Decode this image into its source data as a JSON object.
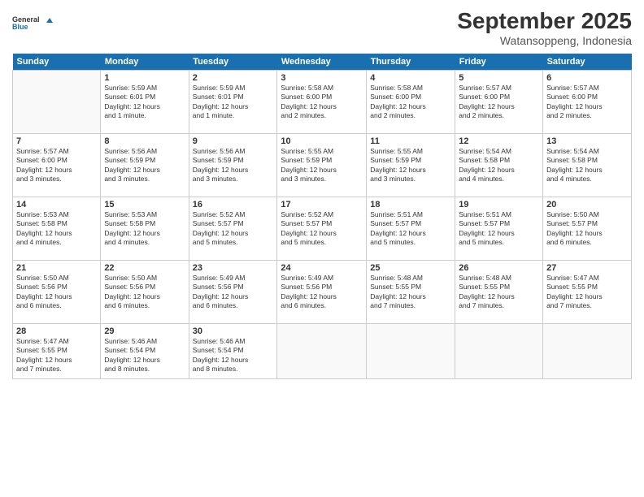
{
  "header": {
    "logo_general": "General",
    "logo_blue": "Blue",
    "month_title": "September 2025",
    "location": "Watansoppeng, Indonesia"
  },
  "days_of_week": [
    "Sunday",
    "Monday",
    "Tuesday",
    "Wednesday",
    "Thursday",
    "Friday",
    "Saturday"
  ],
  "weeks": [
    [
      {
        "day": "",
        "info": ""
      },
      {
        "day": "1",
        "info": "Sunrise: 5:59 AM\nSunset: 6:01 PM\nDaylight: 12 hours\nand 1 minute."
      },
      {
        "day": "2",
        "info": "Sunrise: 5:59 AM\nSunset: 6:01 PM\nDaylight: 12 hours\nand 1 minute."
      },
      {
        "day": "3",
        "info": "Sunrise: 5:58 AM\nSunset: 6:00 PM\nDaylight: 12 hours\nand 2 minutes."
      },
      {
        "day": "4",
        "info": "Sunrise: 5:58 AM\nSunset: 6:00 PM\nDaylight: 12 hours\nand 2 minutes."
      },
      {
        "day": "5",
        "info": "Sunrise: 5:57 AM\nSunset: 6:00 PM\nDaylight: 12 hours\nand 2 minutes."
      },
      {
        "day": "6",
        "info": "Sunrise: 5:57 AM\nSunset: 6:00 PM\nDaylight: 12 hours\nand 2 minutes."
      }
    ],
    [
      {
        "day": "7",
        "info": "Sunrise: 5:57 AM\nSunset: 6:00 PM\nDaylight: 12 hours\nand 3 minutes."
      },
      {
        "day": "8",
        "info": "Sunrise: 5:56 AM\nSunset: 5:59 PM\nDaylight: 12 hours\nand 3 minutes."
      },
      {
        "day": "9",
        "info": "Sunrise: 5:56 AM\nSunset: 5:59 PM\nDaylight: 12 hours\nand 3 minutes."
      },
      {
        "day": "10",
        "info": "Sunrise: 5:55 AM\nSunset: 5:59 PM\nDaylight: 12 hours\nand 3 minutes."
      },
      {
        "day": "11",
        "info": "Sunrise: 5:55 AM\nSunset: 5:59 PM\nDaylight: 12 hours\nand 3 minutes."
      },
      {
        "day": "12",
        "info": "Sunrise: 5:54 AM\nSunset: 5:58 PM\nDaylight: 12 hours\nand 4 minutes."
      },
      {
        "day": "13",
        "info": "Sunrise: 5:54 AM\nSunset: 5:58 PM\nDaylight: 12 hours\nand 4 minutes."
      }
    ],
    [
      {
        "day": "14",
        "info": "Sunrise: 5:53 AM\nSunset: 5:58 PM\nDaylight: 12 hours\nand 4 minutes."
      },
      {
        "day": "15",
        "info": "Sunrise: 5:53 AM\nSunset: 5:58 PM\nDaylight: 12 hours\nand 4 minutes."
      },
      {
        "day": "16",
        "info": "Sunrise: 5:52 AM\nSunset: 5:57 PM\nDaylight: 12 hours\nand 5 minutes."
      },
      {
        "day": "17",
        "info": "Sunrise: 5:52 AM\nSunset: 5:57 PM\nDaylight: 12 hours\nand 5 minutes."
      },
      {
        "day": "18",
        "info": "Sunrise: 5:51 AM\nSunset: 5:57 PM\nDaylight: 12 hours\nand 5 minutes."
      },
      {
        "day": "19",
        "info": "Sunrise: 5:51 AM\nSunset: 5:57 PM\nDaylight: 12 hours\nand 5 minutes."
      },
      {
        "day": "20",
        "info": "Sunrise: 5:50 AM\nSunset: 5:57 PM\nDaylight: 12 hours\nand 6 minutes."
      }
    ],
    [
      {
        "day": "21",
        "info": "Sunrise: 5:50 AM\nSunset: 5:56 PM\nDaylight: 12 hours\nand 6 minutes."
      },
      {
        "day": "22",
        "info": "Sunrise: 5:50 AM\nSunset: 5:56 PM\nDaylight: 12 hours\nand 6 minutes."
      },
      {
        "day": "23",
        "info": "Sunrise: 5:49 AM\nSunset: 5:56 PM\nDaylight: 12 hours\nand 6 minutes."
      },
      {
        "day": "24",
        "info": "Sunrise: 5:49 AM\nSunset: 5:56 PM\nDaylight: 12 hours\nand 6 minutes."
      },
      {
        "day": "25",
        "info": "Sunrise: 5:48 AM\nSunset: 5:55 PM\nDaylight: 12 hours\nand 7 minutes."
      },
      {
        "day": "26",
        "info": "Sunrise: 5:48 AM\nSunset: 5:55 PM\nDaylight: 12 hours\nand 7 minutes."
      },
      {
        "day": "27",
        "info": "Sunrise: 5:47 AM\nSunset: 5:55 PM\nDaylight: 12 hours\nand 7 minutes."
      }
    ],
    [
      {
        "day": "28",
        "info": "Sunrise: 5:47 AM\nSunset: 5:55 PM\nDaylight: 12 hours\nand 7 minutes."
      },
      {
        "day": "29",
        "info": "Sunrise: 5:46 AM\nSunset: 5:54 PM\nDaylight: 12 hours\nand 8 minutes."
      },
      {
        "day": "30",
        "info": "Sunrise: 5:46 AM\nSunset: 5:54 PM\nDaylight: 12 hours\nand 8 minutes."
      },
      {
        "day": "",
        "info": ""
      },
      {
        "day": "",
        "info": ""
      },
      {
        "day": "",
        "info": ""
      },
      {
        "day": "",
        "info": ""
      }
    ]
  ]
}
